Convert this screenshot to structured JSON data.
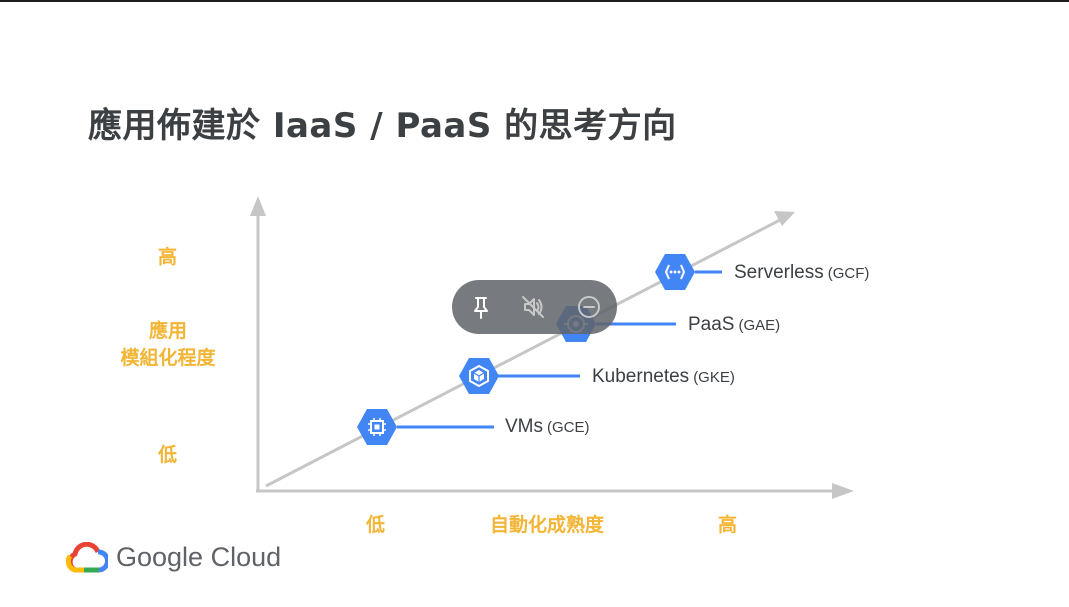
{
  "title": "應用佈建於 IaaS / PaaS 的思考方向",
  "y_axis": {
    "high": "高",
    "label_line1": "應用",
    "label_line2": "模組化程度",
    "low": "低"
  },
  "x_axis": {
    "low": "低",
    "label": "自動化成熟度",
    "high": "高"
  },
  "items": [
    {
      "name": "VMs",
      "abbr": "(GCE)",
      "icon": "compute-engine-icon"
    },
    {
      "name": "Kubernetes",
      "abbr": "(GKE)",
      "icon": "kubernetes-engine-icon"
    },
    {
      "name": "PaaS",
      "abbr": "(GAE)",
      "icon": "app-engine-icon"
    },
    {
      "name": "Serverless",
      "abbr": "(GCF)",
      "icon": "cloud-functions-icon"
    }
  ],
  "overlay_controls": [
    "pin-icon",
    "mute-icon",
    "minimize-icon"
  ],
  "brand": {
    "name": "Google Cloud",
    "colors": {
      "blue": "#4285f4",
      "red": "#ea4335",
      "yellow": "#fbbc04",
      "green": "#34a853"
    }
  },
  "colors": {
    "axis_label": "#f2b535",
    "hex_fill": "#4285f4",
    "connector": "#4285f4",
    "axis": "#c6c6c6",
    "title": "#3c4043"
  }
}
